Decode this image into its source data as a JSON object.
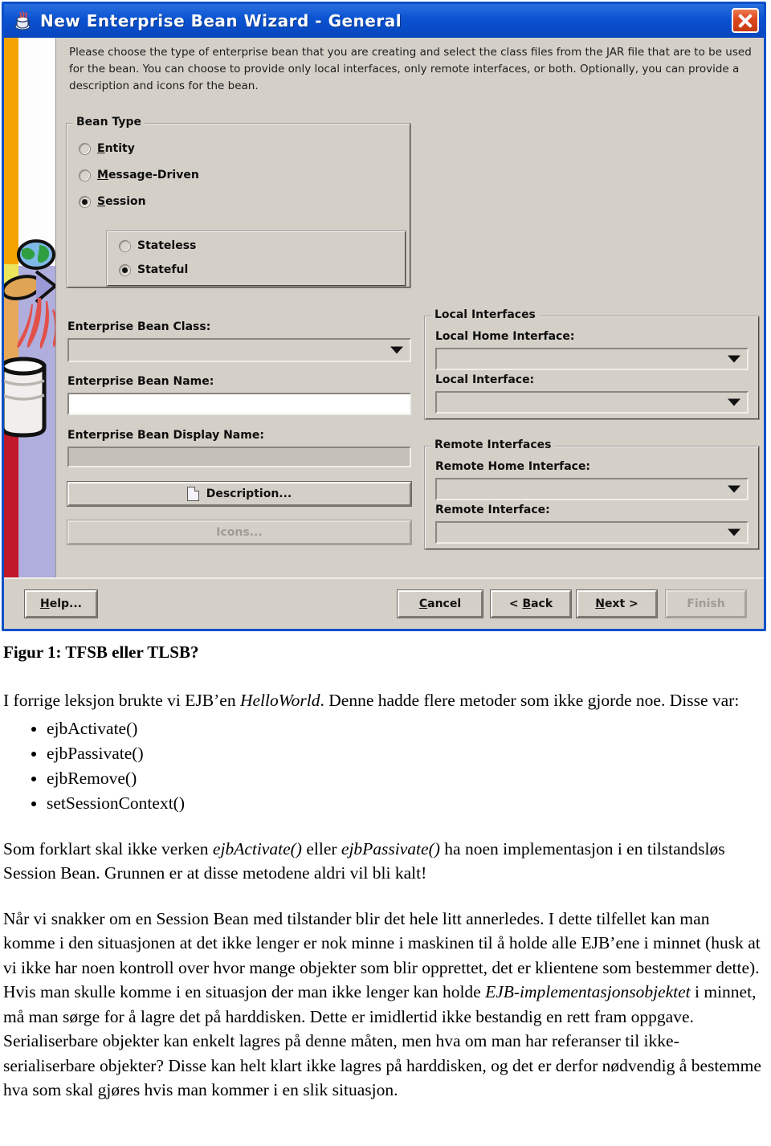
{
  "dialog": {
    "title": "New Enterprise Bean Wizard - General",
    "title_icon": "java-bean-icon",
    "close_label": "close-icon",
    "intro": "Please choose the type of enterprise bean that you are creating and select the class files from the JAR file that are to be used for the bean.  You can choose to provide only local interfaces, only remote interfaces, or both. Optionally, you can provide a description and icons for the bean.",
    "bean_type": {
      "legend": "Bean Type",
      "options": [
        {
          "label": "Entity",
          "mnemonic": "E",
          "selected": false
        },
        {
          "label": "Message-Driven",
          "mnemonic": "M",
          "selected": false
        },
        {
          "label": "Session",
          "mnemonic": "S",
          "selected": true
        }
      ],
      "session_options": [
        {
          "label": "Stateless",
          "selected": false
        },
        {
          "label": "Stateful",
          "selected": true
        }
      ]
    },
    "fields": {
      "bean_class_label": "Enterprise Bean Class:",
      "bean_class_value": "",
      "bean_name_label": "Enterprise Bean Name:",
      "bean_name_value": "",
      "display_name_label": "Enterprise Bean Display Name:",
      "display_name_value": "",
      "description_button": "Description...",
      "icons_button": "Icons..."
    },
    "local_interfaces": {
      "legend": "Local Interfaces",
      "home_label": "Local Home Interface:",
      "home_value": "",
      "iface_label": "Local Interface:",
      "iface_value": ""
    },
    "remote_interfaces": {
      "legend": "Remote Interfaces",
      "home_label": "Remote Home Interface:",
      "home_value": "",
      "iface_label": "Remote Interface:",
      "iface_value": ""
    },
    "buttons": {
      "help": "Help...",
      "cancel": "Cancel",
      "back": "< Back",
      "next": "Next >",
      "finish": "Finish"
    },
    "colors": {
      "titlebar": "#0a52d0",
      "dialog_face": "#d4d0c8",
      "close_button": "#e04a20",
      "banner_orange": "#f5a300",
      "banner_red": "#c1182b",
      "banner_lavender": "#b0aedd"
    }
  },
  "document": {
    "figure_caption": "Figur 1: TFSB eller TLSB?",
    "paragraph1_a": "I forrige leksjon brukte vi EJB’en ",
    "paragraph1_em": "HelloWorld",
    "paragraph1_b": ". Denne hadde flere metoder som ikke gjorde noe. Disse var:",
    "bullets": [
      "ejbActivate()",
      "ejbPassivate()",
      "ejbRemove()",
      "setSessionContext()"
    ],
    "paragraph2_a": "Som forklart skal ikke verken ",
    "paragraph2_em1": "ejbActivate()",
    "paragraph2_b": " eller ",
    "paragraph2_em2": "ejbPassivate()",
    "paragraph2_c": " ha noen implementasjon i en tilstandsløs Session Bean. Grunnen er at disse metodene aldri vil bli kalt!",
    "paragraph3_a": "Når vi snakker om en Session Bean med tilstander blir det hele litt annerledes. I dette tilfellet kan man komme i den situasjonen at det ikke lenger er nok minne i maskinen til å holde alle EJB’ene i minnet (husk at vi ikke har noen kontroll over hvor mange objekter som blir opprettet, det er klientene som bestemmer dette). Hvis man skulle komme i en situasjon der man ikke lenger kan holde ",
    "paragraph3_em": "EJB-implementasjonsobjektet",
    "paragraph3_b": " i minnet, må man sørge for å lagre det på harddisken. Dette er imidlertid ikke bestandig en rett fram oppgave. Serialiserbare objekter kan enkelt lagres på denne måten, men hva om man har referanser til ikke-serialiserbare objekter? Disse kan helt klart ikke lagres på harddisken, og det er derfor nødvendig å bestemme hva som skal gjøres hvis man kommer i en slik situasjon."
  }
}
